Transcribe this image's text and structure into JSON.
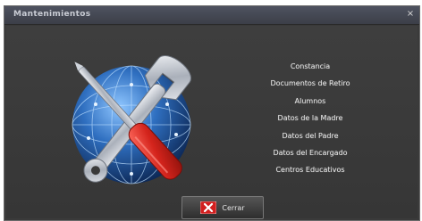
{
  "window": {
    "title": "Mantenimientos",
    "close_glyph": "×"
  },
  "menu": {
    "items": [
      {
        "label": "Constancia"
      },
      {
        "label": "Documentos de Retiro"
      },
      {
        "label": "Alumnos"
      },
      {
        "label": "Datos de la Madre"
      },
      {
        "label": "Datos del Padre"
      },
      {
        "label": "Datos del Encargado"
      },
      {
        "label": "Centros Educativos"
      }
    ]
  },
  "footer": {
    "close_button_label": "Cerrar",
    "close_button_icon": "red-x-icon"
  },
  "logo": {
    "icon": "globe-wrench-screwdriver-icon",
    "colors": {
      "globe": "#2f6fc0",
      "handle": "#d4241c",
      "metal": "#c9ced6"
    }
  }
}
